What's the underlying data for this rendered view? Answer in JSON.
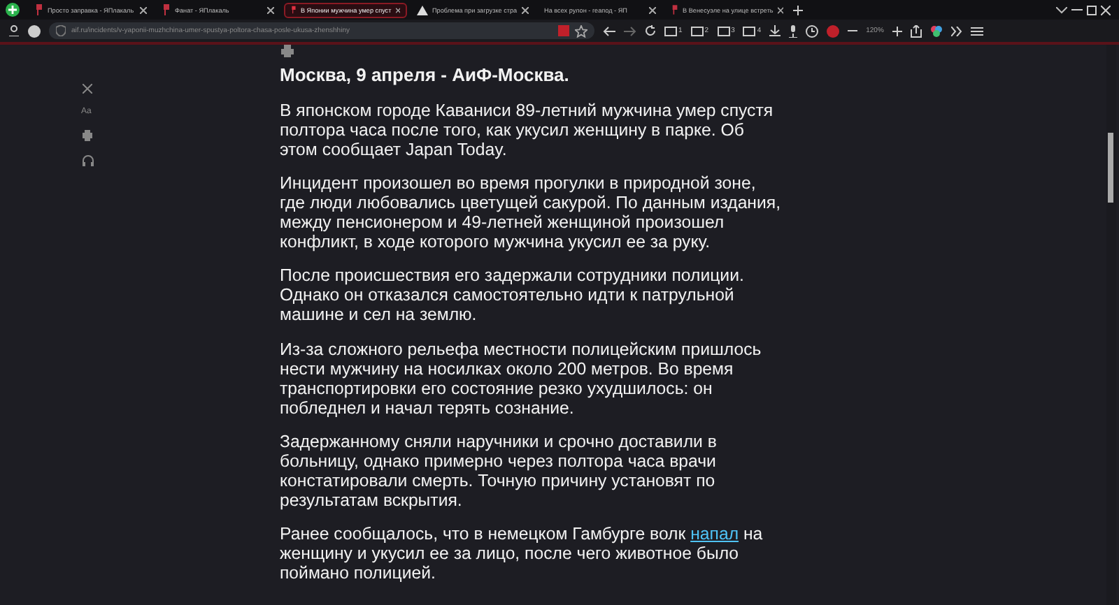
{
  "tabs": [
    {
      "title": "Просто заправка - ЯПлакаль",
      "kind": "site",
      "selected": false
    },
    {
      "title": "Фанат - ЯПлакаль",
      "kind": "site",
      "selected": false
    },
    {
      "title": "В Японии мужчина умер спуст",
      "kind": "site",
      "selected": true
    },
    {
      "title": "Проблема при загрузке стра",
      "kind": "warning",
      "selected": false
    },
    {
      "title": "На всех рулон - геапод - ЯП",
      "kind": "plain",
      "selected": false
    },
    {
      "title": "В Венесуэле на улице встреть",
      "kind": "site",
      "selected": false
    }
  ],
  "address": {
    "url": "aif.ru/incidents/v-yaponii-muzhchina-umer-spustya-poltora-chasa-posle-ukusa-zhenshhiny"
  },
  "toolbar": {
    "groups": [
      "1",
      "2",
      "3",
      "4"
    ],
    "zoom": "120%"
  },
  "article": {
    "heading": "Москва, 9 апреля - АиФ-Москва.",
    "paragraphs": [
      {
        "text": "В японском городе Каваниси 89-летний мужчина умер спустя полтора часа после того, как укусил женщину в парке. Об этом сообщает Japan Today."
      },
      {
        "text": "Инцидент произошел во время прогулки в природной зоне, где люди любовались цветущей сакурой. По данным издания, между пенсионером и 49-летней женщиной произошел конфликт, в ходе которого мужчина укусил ее за руку."
      },
      {
        "text": "После происшествия его задержали сотрудники полиции. Однако он отказался самостоятельно идти к патрульной машине и сел на землю."
      },
      {
        "text": "Из-за сложного рельефа местности полицейским пришлось нести мужчину на носилках около 200 метров. Во время транспортировки его состояние резко ухудшилось: он побледнел и начал терять сознание."
      },
      {
        "text": "Задержанному сняли наручники и срочно доставили в больницу, однако примерно через полтора часа врачи констатировали смерть. Точную причину установят по результатам вскрытия."
      },
      {
        "text": "Ранее сообщалось, что в немецком Гамбурге волк",
        "link": "напал",
        "after": "на женщину и укусил ее за лицо, после чего животное было поймано полицией."
      }
    ]
  },
  "reader_tools": {
    "font_label": "Aa"
  }
}
